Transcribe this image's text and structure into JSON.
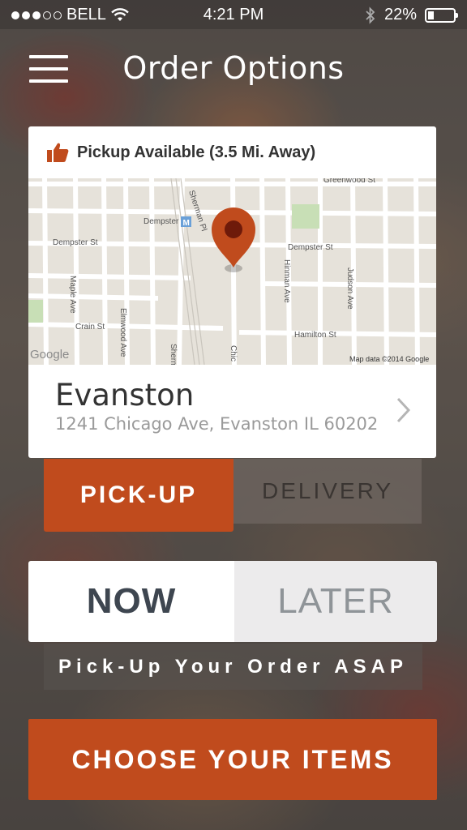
{
  "status_bar": {
    "carrier": "BELL",
    "signal_bars_filled": 3,
    "signal_bars_total": 5,
    "time": "4:21 PM",
    "battery": "22%",
    "battery_level": 0.22
  },
  "header": {
    "title": "Order Options"
  },
  "location_card": {
    "availability": "Pickup Available (3.5 Mi. Away)",
    "map": {
      "streets": [
        "Greenwood St",
        "Dempster St",
        "Dempster St",
        "Sherman Pl",
        "Dempster",
        "Maple Ave",
        "Elmwood Ave",
        "Hinman Ave",
        "Judson Ave",
        "Crain St",
        "Hamilton St",
        "Sherm",
        "Chic"
      ],
      "attribution": "Map data ©2014 Google",
      "logo": "Google"
    },
    "city": "Evanston",
    "address": "1241 Chicago Ave, Evanston IL 60202"
  },
  "order_type": {
    "pickup_label": "PICK-UP",
    "delivery_label": "DELIVERY",
    "selected": "PICK-UP"
  },
  "timing": {
    "now_label": "NOW",
    "later_label": "LATER",
    "selected": "NOW",
    "info": "Pick-Up Your Order ASAP"
  },
  "cta": {
    "label": "CHOOSE YOUR ITEMS"
  },
  "colors": {
    "accent": "#c04b1d",
    "pin": "#c04b1d",
    "text_dark": "#333333"
  },
  "icons": {
    "menu": "hamburger-menu-icon",
    "thumbs": "thumbs-up-icon",
    "pin": "map-pin-icon",
    "chevron": "chevron-right-icon",
    "bluetooth": "bluetooth-icon",
    "wifi": "wifi-icon"
  }
}
